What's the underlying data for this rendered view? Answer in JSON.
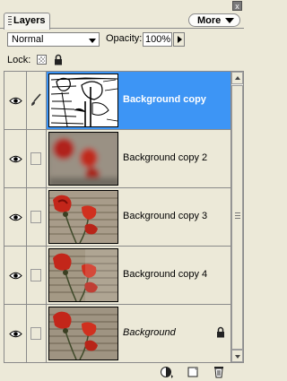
{
  "panel": {
    "tab_label": "Layers",
    "more_label": "More",
    "close_glyph": "x"
  },
  "blend": {
    "mode": "Normal",
    "opacity_label": "Opacity:",
    "opacity_value": "100%"
  },
  "lock": {
    "label": "Lock:"
  },
  "layers": [
    {
      "name": "Background copy",
      "selected": true,
      "visible": true,
      "thumbnail": "line-sketch"
    },
    {
      "name": "Background copy 2",
      "selected": false,
      "visible": true,
      "thumbnail": "blurred-poppies"
    },
    {
      "name": "Background copy 3",
      "selected": false,
      "visible": true,
      "thumbnail": "poppies"
    },
    {
      "name": "Background copy 4",
      "selected": false,
      "visible": true,
      "thumbnail": "poppies"
    },
    {
      "name": "Background",
      "selected": false,
      "visible": true,
      "thumbnail": "poppies",
      "locked": true
    }
  ],
  "icons": {
    "visibility": "eye-icon",
    "brush": "brush-icon",
    "lock_transparent": "checker-lock-icon",
    "lock_all": "padlock-icon",
    "new_adjustment": "adjustment-layer-icon",
    "new_layer": "new-layer-icon",
    "delete": "trash-icon"
  },
  "colors": {
    "panel_bg": "#ece9d8",
    "selection": "#3d95f5"
  }
}
